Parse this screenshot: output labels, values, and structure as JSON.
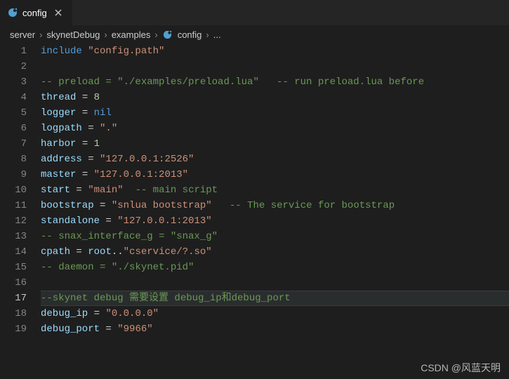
{
  "tab": {
    "title": "config",
    "icon": "lua-icon"
  },
  "breadcrumbs": {
    "items": [
      "server",
      "skynetDebug",
      "examples",
      "config"
    ],
    "trailing": "..."
  },
  "current_line": 17,
  "code": {
    "lines": [
      {
        "n": 1,
        "tokens": [
          {
            "t": "include",
            "c": "kw"
          },
          {
            "t": " ",
            "c": "op"
          },
          {
            "t": "\"config.path\"",
            "c": "str"
          }
        ]
      },
      {
        "n": 2,
        "tokens": []
      },
      {
        "n": 3,
        "tokens": [
          {
            "t": "-- preload = \"./examples/preload.lua\"   -- run preload.lua before",
            "c": "comment"
          }
        ]
      },
      {
        "n": 4,
        "tokens": [
          {
            "t": "thread",
            "c": "ident"
          },
          {
            "t": " = ",
            "c": "op"
          },
          {
            "t": "8",
            "c": "num"
          }
        ]
      },
      {
        "n": 5,
        "tokens": [
          {
            "t": "logger",
            "c": "ident"
          },
          {
            "t": " = ",
            "c": "op"
          },
          {
            "t": "nil",
            "c": "kw"
          }
        ]
      },
      {
        "n": 6,
        "tokens": [
          {
            "t": "logpath",
            "c": "ident"
          },
          {
            "t": " = ",
            "c": "op"
          },
          {
            "t": "\".\"",
            "c": "str"
          }
        ]
      },
      {
        "n": 7,
        "tokens": [
          {
            "t": "harbor",
            "c": "ident"
          },
          {
            "t": " = ",
            "c": "op"
          },
          {
            "t": "1",
            "c": "num"
          }
        ]
      },
      {
        "n": 8,
        "tokens": [
          {
            "t": "address",
            "c": "ident"
          },
          {
            "t": " = ",
            "c": "op"
          },
          {
            "t": "\"127.0.0.1:2526\"",
            "c": "str"
          }
        ]
      },
      {
        "n": 9,
        "tokens": [
          {
            "t": "master",
            "c": "ident"
          },
          {
            "t": " = ",
            "c": "op"
          },
          {
            "t": "\"127.0.0.1:2013\"",
            "c": "str"
          }
        ]
      },
      {
        "n": 10,
        "tokens": [
          {
            "t": "start",
            "c": "ident"
          },
          {
            "t": " = ",
            "c": "op"
          },
          {
            "t": "\"main\"",
            "c": "str"
          },
          {
            "t": "  ",
            "c": "op"
          },
          {
            "t": "-- main script",
            "c": "comment"
          }
        ]
      },
      {
        "n": 11,
        "tokens": [
          {
            "t": "bootstrap",
            "c": "ident"
          },
          {
            "t": " = ",
            "c": "op"
          },
          {
            "t": "\"snlua bootstrap\"",
            "c": "str"
          },
          {
            "t": "   ",
            "c": "op"
          },
          {
            "t": "-- The service for bootstrap",
            "c": "comment"
          }
        ]
      },
      {
        "n": 12,
        "tokens": [
          {
            "t": "standalone",
            "c": "ident"
          },
          {
            "t": " = ",
            "c": "op"
          },
          {
            "t": "\"127.0.0.1:2013\"",
            "c": "str"
          }
        ]
      },
      {
        "n": 13,
        "tokens": [
          {
            "t": "-- snax_interface_g = \"snax_g\"",
            "c": "comment"
          }
        ]
      },
      {
        "n": 14,
        "tokens": [
          {
            "t": "cpath",
            "c": "ident"
          },
          {
            "t": " = ",
            "c": "op"
          },
          {
            "t": "root",
            "c": "ident"
          },
          {
            "t": "..",
            "c": "op"
          },
          {
            "t": "\"cservice/?.so\"",
            "c": "str"
          }
        ]
      },
      {
        "n": 15,
        "tokens": [
          {
            "t": "-- daemon = \"./skynet.pid\"",
            "c": "comment"
          }
        ]
      },
      {
        "n": 16,
        "tokens": []
      },
      {
        "n": 17,
        "tokens": [
          {
            "t": "--skynet debug 需要设置 debug_ip和debug_port",
            "c": "comment"
          }
        ]
      },
      {
        "n": 18,
        "tokens": [
          {
            "t": "debug_ip",
            "c": "ident"
          },
          {
            "t": " = ",
            "c": "op"
          },
          {
            "t": "\"0.0.0.0\"",
            "c": "str"
          }
        ]
      },
      {
        "n": 19,
        "tokens": [
          {
            "t": "debug_port",
            "c": "ident"
          },
          {
            "t": " = ",
            "c": "op"
          },
          {
            "t": "\"9966\"",
            "c": "str"
          }
        ]
      }
    ]
  },
  "watermark": "CSDN @风蓝天明"
}
